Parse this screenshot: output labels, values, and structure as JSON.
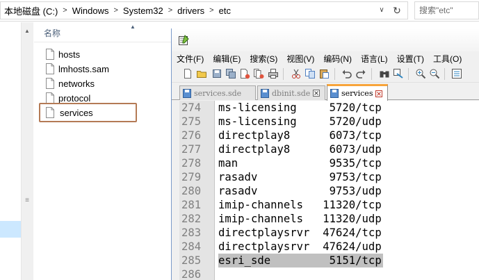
{
  "explorer": {
    "breadcrumbs": [
      "本地磁盘 (C:)",
      "Windows",
      "System32",
      "drivers",
      "etc"
    ],
    "search_placeholder": "搜索\"etc\"",
    "column_header": "名称",
    "files": [
      {
        "name": "hosts",
        "selected": false
      },
      {
        "name": "lmhosts.sam",
        "selected": false
      },
      {
        "name": "networks",
        "selected": false
      },
      {
        "name": "protocol",
        "selected": false
      },
      {
        "name": "services",
        "selected": true
      }
    ]
  },
  "notepad": {
    "menu": [
      "文件(F)",
      "编辑(E)",
      "搜索(S)",
      "视图(V)",
      "编码(N)",
      "语言(L)",
      "设置(T)",
      "工具(O)"
    ],
    "tabs": [
      {
        "label": "services.sde",
        "active": false
      },
      {
        "label": "dbinit.sde",
        "active": false
      },
      {
        "label": "services",
        "active": true
      }
    ],
    "lines": [
      {
        "num": "274",
        "text": "ms-licensing     5720/tcp"
      },
      {
        "num": "275",
        "text": "ms-licensing     5720/udp"
      },
      {
        "num": "276",
        "text": "directplay8      6073/tcp"
      },
      {
        "num": "277",
        "text": "directplay8      6073/udp"
      },
      {
        "num": "278",
        "text": "man              9535/tcp"
      },
      {
        "num": "279",
        "text": "rasadv           9753/tcp"
      },
      {
        "num": "280",
        "text": "rasadv           9753/udp"
      },
      {
        "num": "281",
        "text": "imip-channels   11320/tcp"
      },
      {
        "num": "282",
        "text": "imip-channels   11320/udp"
      },
      {
        "num": "283",
        "text": "directplaysrvr  47624/tcp"
      },
      {
        "num": "284",
        "text": "directplaysrvr  47624/udp"
      },
      {
        "num": "285",
        "text": "esri_sde         5151/tcp",
        "highlighted": true
      },
      {
        "num": "286",
        "text": ""
      }
    ]
  },
  "colors": {
    "selection_box": "#b47a55",
    "active_tab_accent": "#f8a43a",
    "line_highlight": "#c0c0c0",
    "gutter": "#e4e4e4"
  },
  "icons": {
    "file": "document-icon",
    "refresh": "refresh-icon",
    "dropdown": "chevron-down-icon",
    "tab_close": "close-icon"
  }
}
